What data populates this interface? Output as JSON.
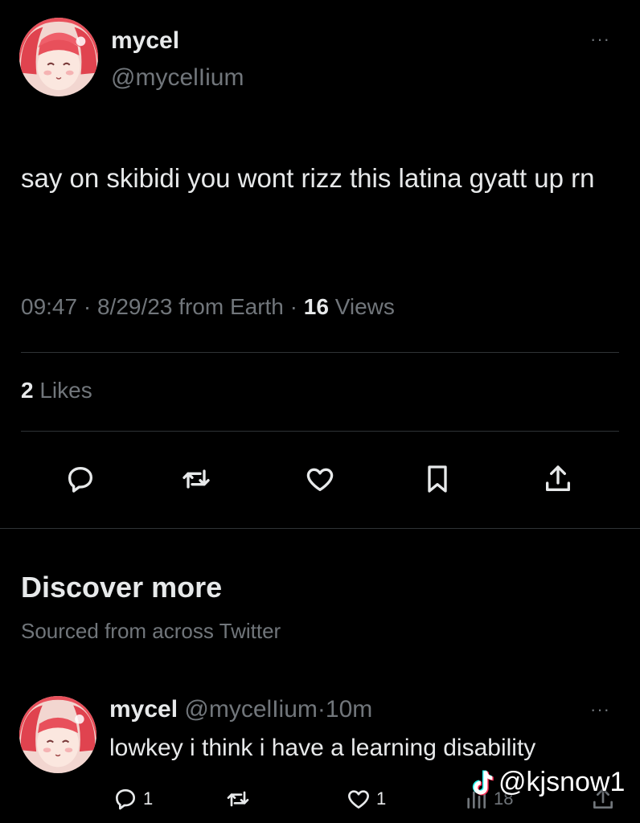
{
  "tweet": {
    "display_name": "mycel",
    "handle": "@mycelIium",
    "more_label": "···",
    "text": "say on skibidi you wont rizz this latina gyatt up rn",
    "time": "09:47",
    "date": "8/29/23",
    "source": "from Earth",
    "views_count": "16",
    "views_label": "Views",
    "likes_count": "2",
    "likes_label": "Likes",
    "actions": [
      {
        "icon": "reply-icon"
      },
      {
        "icon": "retweet-icon"
      },
      {
        "icon": "like-icon"
      },
      {
        "icon": "bookmark-icon"
      },
      {
        "icon": "share-icon"
      }
    ]
  },
  "discover": {
    "title": "Discover more",
    "subtitle": "Sourced from across Twitter"
  },
  "reply": {
    "display_name": "mycel",
    "handle": "@mycelIium",
    "time": "10m",
    "more_label": "···",
    "text": "lowkey i think i have a learning disability",
    "reply_count": "1",
    "like_count": "1",
    "view_count": "18"
  },
  "watermark": {
    "text": "@kjsnow1",
    "icon": "tiktok-icon"
  },
  "colors": {
    "background": "#000000",
    "text_primary": "#e7e9ea",
    "text_secondary": "#71767b",
    "divider": "#2f3336"
  }
}
